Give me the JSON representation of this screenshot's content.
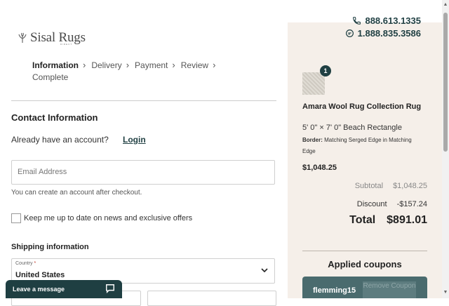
{
  "header": {
    "phone_primary": "888.613.1335",
    "phone_secondary": "1.888.835.3586",
    "logo_text": "Sisal Rugs",
    "logo_sub": "DIRECT"
  },
  "steps": [
    {
      "label": "Information",
      "active": true
    },
    {
      "label": "Delivery"
    },
    {
      "label": "Payment"
    },
    {
      "label": "Review"
    },
    {
      "label": "Complete"
    }
  ],
  "contact": {
    "heading": "Contact Information",
    "account_question": "Already have an account?",
    "login_label": "Login",
    "email_placeholder": "Email Address",
    "email_hint": "You can create an account after checkout.",
    "newsletter_label": "Keep me up to date on news and exclusive offers"
  },
  "shipping": {
    "heading": "Shipping information",
    "country_label": "Country",
    "country_required": "*",
    "country_value": "United States"
  },
  "chat": {
    "label": "Leave a message"
  },
  "order": {
    "quantity": "1",
    "product_name": "Amara Wool Rug Collection Rug",
    "size": "5' 0\" × 7' 0\" Beach Rectangle",
    "border_label": "Border:",
    "border_value": "Matching Serged Edge in Matching Edge",
    "price": "$1,048.25",
    "subtotal_label": "Subtotal",
    "subtotal_value": "$1,048.25",
    "discount_label": "Discount",
    "discount_value": "-$157.24",
    "total_label": "Total",
    "total_value": "$891.01"
  },
  "coupons": {
    "heading": "Applied coupons",
    "code": "flemming15",
    "remove_label": "Remove Coupon"
  },
  "colors": {
    "brand": "#1f3f42",
    "summary_bg": "#f5efe9"
  }
}
